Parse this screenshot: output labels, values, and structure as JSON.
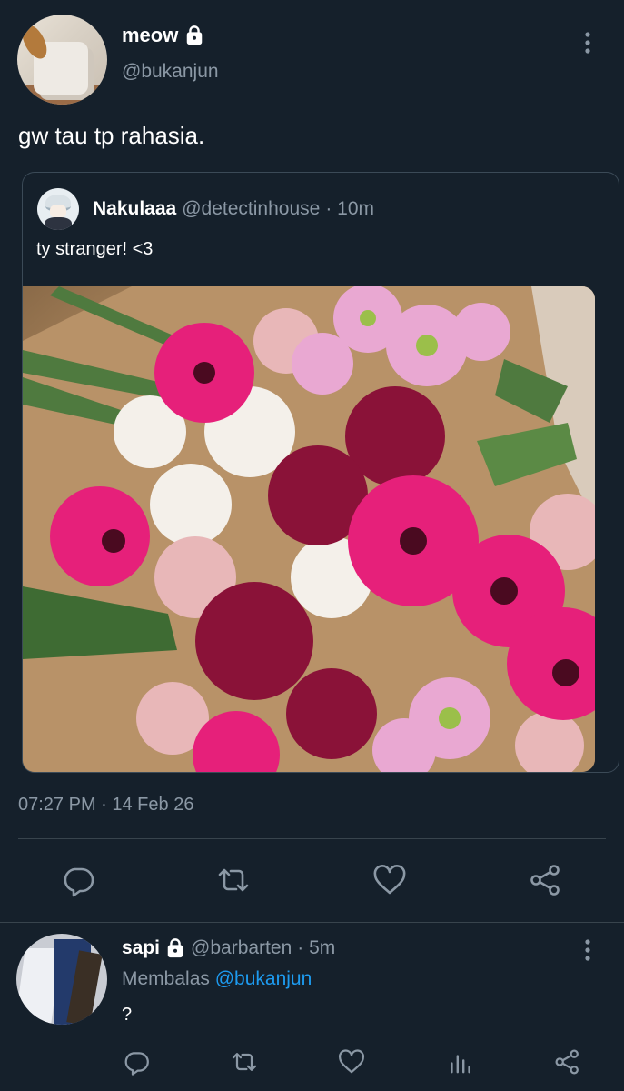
{
  "tweet": {
    "display_name": "meow",
    "handle": "@bukanjun",
    "text": "gw tau tp rahasia.",
    "timestamp": "07:27 PM · 14 Feb 26",
    "quoted": {
      "display_name": "Nakulaaa",
      "handle": "@detectinhouse",
      "time": "· 10m",
      "text": "ty stranger! <3"
    },
    "actions": [
      "reply-icon",
      "retweet-icon",
      "like-icon",
      "share-icon"
    ]
  },
  "reply": {
    "display_name": "sapi",
    "handle": "@barbarten",
    "time": "· 5m",
    "replying_prefix": "Membalas",
    "replying_to": "@bukanjun",
    "text": "?",
    "actions": [
      "reply-icon",
      "retweet-icon",
      "like-icon",
      "analytics-icon",
      "share-icon"
    ]
  },
  "colors": {
    "background": "#15202b",
    "muted": "#8b98a5",
    "accent": "#1d9bf0",
    "divider": "#38444d"
  }
}
